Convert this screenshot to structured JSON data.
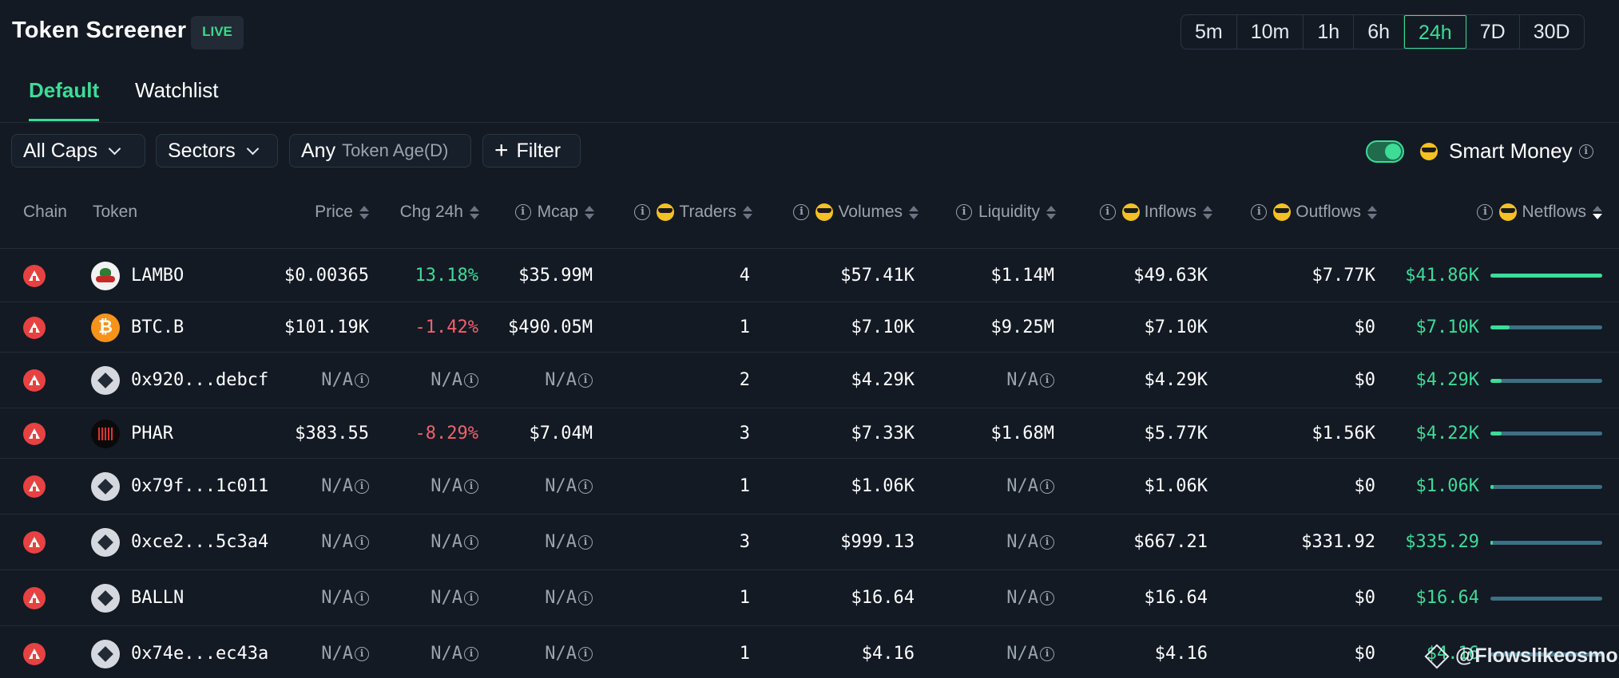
{
  "header": {
    "title": "Token Screener",
    "live_badge": "LIVE",
    "timeframes": [
      "5m",
      "10m",
      "1h",
      "6h",
      "24h",
      "7D",
      "30D"
    ],
    "active_timeframe": "24h"
  },
  "tabs": [
    {
      "label": "Default",
      "active": true
    },
    {
      "label": "Watchlist",
      "active": false
    }
  ],
  "filters": {
    "caps": "All Caps",
    "sectors": "Sectors",
    "age_value": "Any",
    "age_label": "Token Age(D)",
    "filter_button": "Filter",
    "smart_money_label": "Smart Money",
    "smart_money_enabled": true
  },
  "table": {
    "columns": {
      "chain": "Chain",
      "token": "Token",
      "price": "Price",
      "chg": "Chg 24h",
      "mcap": "Mcap",
      "traders": "Traders",
      "volumes": "Volumes",
      "liquidity": "Liquidity",
      "inflows": "Inflows",
      "outflows": "Outflows",
      "netflows": "Netflows"
    },
    "rows": [
      {
        "token": "LAMBO",
        "icon": "lambo-token-icon",
        "price": "$0.00365",
        "chg": "13.18%",
        "chg_dir": "up",
        "mcap": "$35.99M",
        "traders": "4",
        "volumes": "$57.41K",
        "liquidity": "$1.14M",
        "inflows": "$49.63K",
        "outflows": "$7.77K",
        "netflows": "$41.86K",
        "netflow_fraction": 1.0
      },
      {
        "token": "BTC.B",
        "icon": "bitcoin-token-icon",
        "price": "$101.19K",
        "chg": "-1.42%",
        "chg_dir": "down",
        "mcap": "$490.05M",
        "traders": "1",
        "volumes": "$7.10K",
        "liquidity": "$9.25M",
        "inflows": "$7.10K",
        "outflows": "$0",
        "netflows": "$7.10K",
        "netflow_fraction": 0.17
      },
      {
        "token": "0x920...debcf",
        "icon": "generic-token-icon",
        "price": "N/A",
        "chg": "N/A",
        "chg_dir": "na",
        "mcap": "N/A",
        "traders": "2",
        "volumes": "$4.29K",
        "liquidity": "N/A",
        "inflows": "$4.29K",
        "outflows": "$0",
        "netflows": "$4.29K",
        "netflow_fraction": 0.1
      },
      {
        "token": "PHAR",
        "icon": "phar-token-icon",
        "price": "$383.55",
        "chg": "-8.29%",
        "chg_dir": "down",
        "mcap": "$7.04M",
        "traders": "3",
        "volumes": "$7.33K",
        "liquidity": "$1.68M",
        "inflows": "$5.77K",
        "outflows": "$1.56K",
        "netflows": "$4.22K",
        "netflow_fraction": 0.1
      },
      {
        "token": "0x79f...1c011",
        "icon": "generic-token-icon",
        "price": "N/A",
        "chg": "N/A",
        "chg_dir": "na",
        "mcap": "N/A",
        "traders": "1",
        "volumes": "$1.06K",
        "liquidity": "N/A",
        "inflows": "$1.06K",
        "outflows": "$0",
        "netflows": "$1.06K",
        "netflow_fraction": 0.025
      },
      {
        "token": "0xce2...5c3a4",
        "icon": "generic-token-icon",
        "price": "N/A",
        "chg": "N/A",
        "chg_dir": "na",
        "mcap": "N/A",
        "traders": "3",
        "volumes": "$999.13",
        "liquidity": "N/A",
        "inflows": "$667.21",
        "outflows": "$331.92",
        "netflows": "$335.29",
        "netflow_fraction": 0.008
      },
      {
        "token": "BALLN",
        "icon": "generic-token-icon",
        "price": "N/A",
        "chg": "N/A",
        "chg_dir": "na",
        "mcap": "N/A",
        "traders": "1",
        "volumes": "$16.64",
        "liquidity": "N/A",
        "inflows": "$16.64",
        "outflows": "$0",
        "netflows": "$16.64",
        "netflow_fraction": 0.0
      },
      {
        "token": "0x74e...ec43a",
        "icon": "generic-token-icon",
        "price": "N/A",
        "chg": "N/A",
        "chg_dir": "na",
        "mcap": "N/A",
        "traders": "1",
        "volumes": "$4.16",
        "liquidity": "N/A",
        "inflows": "$4.16",
        "outflows": "$0",
        "netflows": "$4.16",
        "netflow_fraction": 0.0
      }
    ]
  },
  "watermark": "@Flowslikeosmo",
  "colors": {
    "accent": "#3ddc97",
    "negative": "#f0616d",
    "background": "#131a24",
    "chain": "#e84142"
  }
}
